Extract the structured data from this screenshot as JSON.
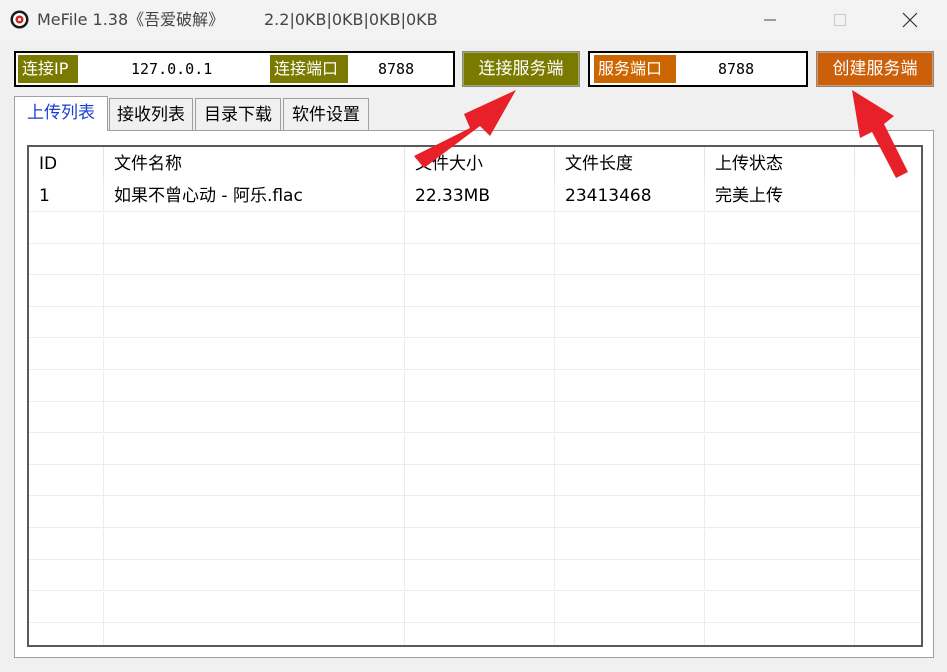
{
  "window": {
    "title": "MeFile 1.38《吾爱破解》",
    "stats": "2.2|0KB|0KB|0KB|0KB"
  },
  "connection": {
    "ip_label": "连接IP",
    "ip_value": "127.0.0.1",
    "port_label": "连接端口",
    "port_value": "8788",
    "connect_button": "连接服务端"
  },
  "service": {
    "port_label": "服务端口",
    "port_value": "8788",
    "create_button": "创建服务端"
  },
  "tabs": [
    {
      "label": "上传列表",
      "active": true
    },
    {
      "label": "接收列表",
      "active": false
    },
    {
      "label": "目录下载",
      "active": false
    },
    {
      "label": "软件设置",
      "active": false
    }
  ],
  "table": {
    "columns": [
      "ID",
      "文件名称",
      "文件大小",
      "文件长度",
      "上传状态"
    ],
    "rows": [
      [
        "1",
        "如果不曾心动 - 阿乐.flac",
        "22.33MB",
        "23413468",
        "完美上传"
      ]
    ]
  },
  "colors": {
    "olive": "#7a7a00",
    "orange": "#cc6600",
    "active_tab_text": "#1a3fd1",
    "annotation_arrow": "#e8202a"
  }
}
